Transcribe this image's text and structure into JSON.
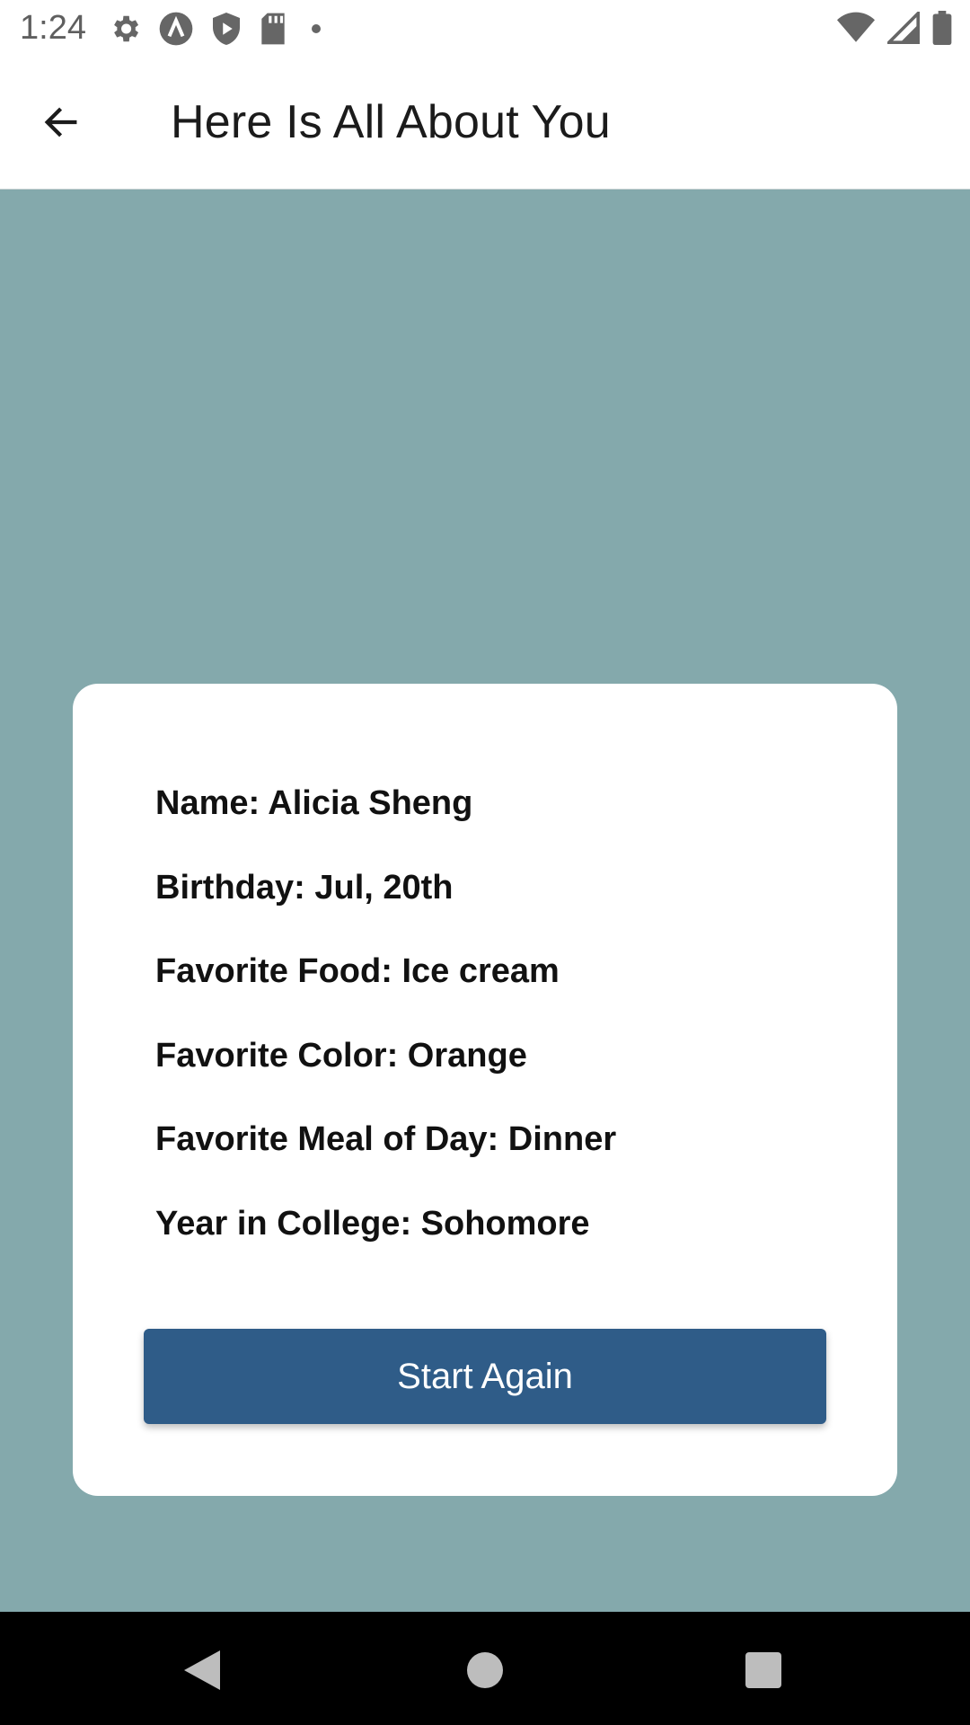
{
  "status_bar": {
    "time": "1:24",
    "icons_left": [
      "settings-icon",
      "a-circle-icon",
      "shield-play-icon",
      "sd-card-icon",
      "dot-icon"
    ],
    "icons_right": [
      "wifi-icon",
      "cell-signal-icon",
      "battery-icon"
    ]
  },
  "app_bar": {
    "back_icon": "arrow-back-icon",
    "title": "Here Is All About You"
  },
  "card": {
    "items": [
      "Name: Alicia Sheng",
      "Birthday: Jul, 20th",
      "Favorite Food: Ice cream",
      "Favorite Color: Orange",
      "Favorite Meal of Day: Dinner",
      "Year in College: Sohomore"
    ],
    "button_label": "Start Again"
  },
  "nav_bar": {
    "icons": [
      "nav-back-icon",
      "nav-home-icon",
      "nav-recents-icon"
    ]
  },
  "colors": {
    "background": "#84A9AC",
    "button": "#2F5C88",
    "card": "#FFFFFF"
  }
}
